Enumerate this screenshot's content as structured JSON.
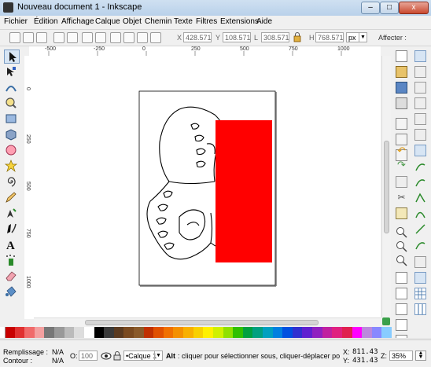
{
  "window": {
    "title": "Nouveau document 1 - Inkscape",
    "minimize_glyph": "–",
    "maximize_glyph": "□",
    "close_glyph": "x"
  },
  "menu": {
    "items": [
      "Fichier",
      "Édition",
      "Affichage",
      "Calque",
      "Objet",
      "Chemin",
      "Texte",
      "Filtres",
      "Extensions",
      "Aide"
    ]
  },
  "toolbar": {
    "x_label": "X",
    "x_value": "428.571",
    "y_label": "Y",
    "y_value": "108.571",
    "w_label": "L",
    "w_value": "308.571",
    "h_label": "H",
    "h_value": "768.571",
    "unit": "px",
    "affecter_label": "Affecter :"
  },
  "rulers": {
    "h_labels": [
      "-500",
      "-250",
      "0",
      "250",
      "500",
      "750",
      "1000"
    ],
    "v_labels": [
      "0",
      "250",
      "500",
      "750",
      "1000"
    ]
  },
  "colors": {
    "accent_red": "#ff0000",
    "page_border": "#000000",
    "selection_tool_highlight": "#d7e5f4"
  },
  "palette": {
    "colors": [
      "#c80000",
      "#e03030",
      "#f06a6a",
      "#f4a0a0",
      "#777777",
      "#999999",
      "#bbbbbb",
      "#dddddd",
      "#ffffff",
      "#000000",
      "#3a3a3a",
      "#5a3a20",
      "#7a4a20",
      "#8a5a2a",
      "#c03000",
      "#e05000",
      "#f07000",
      "#f49000",
      "#f8b000",
      "#f8d000",
      "#fff000",
      "#d0f000",
      "#90e000",
      "#30c000",
      "#00a040",
      "#00a080",
      "#00a0c0",
      "#0080e0",
      "#0050e0",
      "#3030d0",
      "#6020d0",
      "#9020c0",
      "#c020a0",
      "#e02080",
      "#e02050",
      "#ff00ff",
      "#bb88dd",
      "#8888ff",
      "#88ccff"
    ]
  },
  "status": {
    "fill_label": "Remplissage :",
    "fill_value": "N/A",
    "stroke_label": "Contour :",
    "stroke_value": "N/A",
    "opacity_label": "O:",
    "opacity_value": "100",
    "layer": "•Calque 1",
    "hint_bold": "Alt",
    "hint": ": cliquer pour sélectionner sous, cliquer-déplacer pour dépl",
    "x_label": "X:",
    "x_value": "811.43",
    "y_label": "Y:",
    "y_value": "431.43",
    "zoom_label": "Z:",
    "zoom_value": "35%"
  }
}
